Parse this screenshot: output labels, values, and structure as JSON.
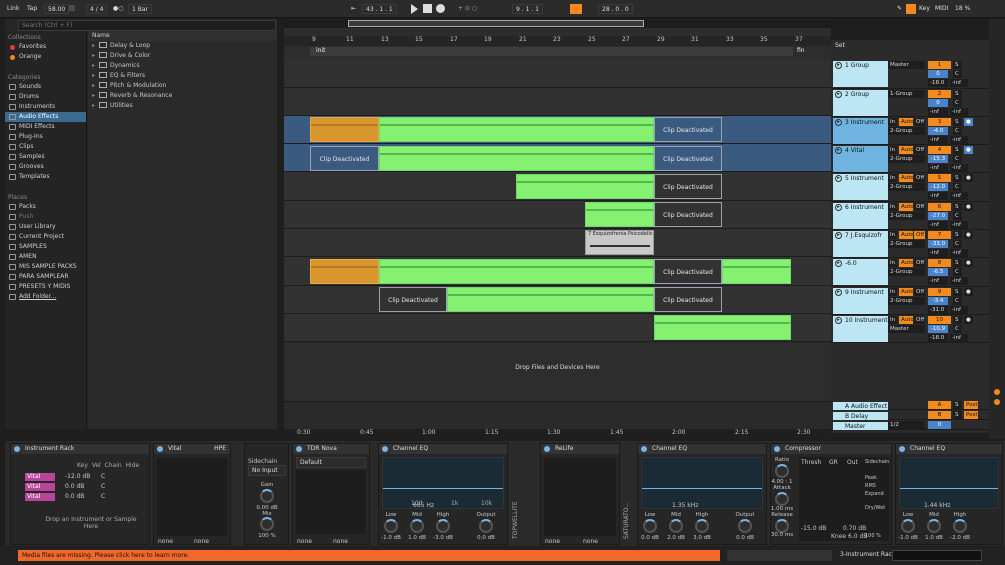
{
  "topbar": {
    "link": "Link",
    "tap": "Tap",
    "bpm": "58.00",
    "sig": "4 / 4",
    "quant": "1 Bar",
    "pos": "43 .  1 .  1",
    "loop_pos": "9 .  1 .  1",
    "loop_len": "28 .  0 .  0",
    "key": "Key",
    "midi": "MIDI",
    "cpu": "18 %"
  },
  "browser": {
    "search_placeholder": "Search (Ctrl + F)",
    "collections_title": "Collections",
    "collections": [
      {
        "label": "Favorites",
        "color": "#e33b3b"
      },
      {
        "label": "Orange",
        "color": "#f28a1e"
      }
    ],
    "categories_title": "Categories",
    "categories": [
      "Sounds",
      "Drums",
      "Instruments",
      "Audio Effects",
      "MIDI Effects",
      "Plug-Ins",
      "Clips",
      "Samples",
      "Grooves",
      "Templates"
    ],
    "places_title": "Places",
    "places": [
      "Packs",
      "Push",
      "User Library",
      "Current Project",
      "SAMPLES",
      "AMEN",
      "MIS SAMPLE PACKS",
      "PARA SAMPLEAR",
      "PRESETS Y MIDIS",
      "Add Folder..."
    ],
    "name_header": "Name",
    "files": [
      "Delay & Loop",
      "Drive & Color",
      "Dynamics",
      "EQ & Filters",
      "Pitch & Modulation",
      "Reverb & Resonance",
      "Utilities"
    ]
  },
  "ruler": [
    "9",
    "11",
    "13",
    "15",
    "17",
    "19",
    "21",
    "23",
    "25",
    "27",
    "29",
    "31",
    "33",
    "35",
    "37"
  ],
  "markers": {
    "init": "init",
    "fin": "fin"
  },
  "timeline": [
    "0:30",
    "0:45",
    "1:00",
    "1:15",
    "1:30",
    "1:45",
    "2:00",
    "2:15",
    "2:30"
  ],
  "clip_deactivated": "Clip Deactivated",
  "esq_clip": "7 Esquizofrenia Psicodelica",
  "drop_text": "Drop Files and Devices Here",
  "mixer": {
    "set_label": "Set",
    "tracks": [
      {
        "name": "1 Group",
        "route1": "Master",
        "num": "1",
        "vol": "0",
        "pan": "C",
        "db": "-18.0",
        "db2": "-inf"
      },
      {
        "name": "2 Group",
        "route1": "1-Group",
        "num": "2",
        "vol": "0",
        "pan": "C",
        "db": "-inf",
        "db2": "-inf"
      },
      {
        "name": "3 Instrument",
        "route1": "In",
        "auto": "Auto",
        "off": "Off",
        "route2": "2-Group",
        "num": "3",
        "vol": "-4.0",
        "pan": "C",
        "db": "-inf",
        "db2": "-inf"
      },
      {
        "name": "4 Vital",
        "route1": "In",
        "auto": "Auto",
        "off": "Off",
        "route2": "2-Group",
        "num": "4",
        "vol": "-15.3",
        "pan": "C",
        "db": "-inf",
        "db2": "-inf"
      },
      {
        "name": "5 Instrument",
        "route1": "In",
        "auto": "Auto",
        "off": "Off",
        "route2": "2-Group",
        "num": "5",
        "vol": "-12.0",
        "pan": "C",
        "db": "-inf",
        "db2": "-inf"
      },
      {
        "name": "6 Instrument",
        "route1": "In",
        "auto": "Auto",
        "off": "Off",
        "route2": "2-Group",
        "num": "6",
        "vol": "-27.0",
        "pan": "C",
        "db": "-inf",
        "db2": "-inf"
      },
      {
        "name": "7 J.Esquizofr",
        "route1": "In",
        "auto": "Auto",
        "off": "Off",
        "route2": "2-Group",
        "num": "7",
        "vol": "-33.0",
        "pan": "C",
        "db": "-inf",
        "db2": "-inf"
      },
      {
        "name": "-6.0",
        "route1": "In",
        "auto": "Auto",
        "off": "Off",
        "route2": "2-Group",
        "num": "8",
        "vol": "-6.5",
        "pan": "C",
        "db": "-inf",
        "db2": "-inf"
      },
      {
        "name": "9 Instrument",
        "route1": "In",
        "auto": "Auto",
        "off": "Off",
        "route2": "2-Group",
        "num": "9",
        "vol": "-3.4",
        "pan": "C",
        "db": "-31.0",
        "db2": "-inf"
      },
      {
        "name": "10 Instrument",
        "route1": "In",
        "auto": "Auto",
        "off": "Off",
        "route2": "Master",
        "num": "10",
        "vol": "-10.9",
        "pan": "C",
        "db": "-18.0",
        "db2": "-inf"
      }
    ],
    "returns": [
      {
        "name": "A Audio Effect",
        "num": "A",
        "post": "Post"
      },
      {
        "name": "B Delay",
        "num": "B",
        "post": "Post"
      },
      {
        "name": "Master",
        "route": "1/2",
        "num": "0"
      }
    ]
  },
  "devices": {
    "rack": {
      "title": "Instrument Rack",
      "rows": [
        {
          "name": "Vital",
          "vol": "-12.0 dB",
          "pan": "C"
        },
        {
          "name": "Vital",
          "vol": "0.0 dB",
          "pan": "C"
        },
        {
          "name": "Vital",
          "vol": "0.0 dB",
          "pan": "C"
        }
      ],
      "hint": "Drop an Instrument or Sample Here",
      "tabs": [
        "Key",
        "Vel",
        "Chain",
        "Hide"
      ]
    },
    "vital": {
      "title": "Vital",
      "hpf": "HPE",
      "none1": "none",
      "none2": "none"
    },
    "tdr": {
      "sidechain": "Sidechain",
      "input": "No Input",
      "gain": "Gain",
      "gain_val": "0.00 dB",
      "mix": "Mix",
      "mix_val": "100 %",
      "mute": "Mute"
    },
    "tdrnova": {
      "title": "TDR Nova",
      "preset": "Default",
      "none1": "none",
      "none2": "none"
    },
    "eq1": {
      "title": "Channel EQ",
      "freq": "665 Hz",
      "labels": [
        "Low",
        "Mid",
        "High",
        "Output"
      ],
      "vals": [
        "-1.0 dB",
        "1.0 dB",
        "-3.0 dB",
        "0.0 dB"
      ],
      "axis": [
        "100",
        "1k",
        "10k"
      ],
      "side": "TOPWELLITE"
    },
    "relife": {
      "title": "ReLife",
      "none1": "none",
      "none2": "none",
      "side": "SATURATO..."
    },
    "eq2": {
      "title": "Channel EQ",
      "freq": "1.35 kHz",
      "labels": [
        "Low",
        "Mid",
        "High",
        "Output"
      ],
      "vals": [
        "0.0 dB",
        "2.0 dB",
        "3.0 dB",
        "0.0 dB"
      ]
    },
    "comp": {
      "title": "Compressor",
      "ratio": "Ratio",
      "ratio_val": "4.00 : 1",
      "attack": "Attack",
      "attack_val": "1.00 ms",
      "release": "Release",
      "release_val": "30.0 ms",
      "thresh": "Thresh",
      "gr": "GR",
      "out": "Out",
      "thresh_val": "-15.0 dB",
      "out_val": "0.70 dB",
      "knee": "Knee 6.0 dB",
      "drywet": "Dry/Wet",
      "drywet_val": "100 %",
      "side_labels": [
        "Sidechain",
        "Peak",
        "RMS",
        "Expand"
      ]
    },
    "eq3": {
      "title": "Channel EQ",
      "freq": "1.44 kHz",
      "labels": [
        "Low",
        "Mid",
        "High"
      ],
      "vals": [
        "-1.0 dB",
        "1.0 dB",
        "-2.0 dB"
      ]
    }
  },
  "status": {
    "message": "Media files are missing. Please click here to learn more.",
    "device": "3-Instrument Rack"
  }
}
